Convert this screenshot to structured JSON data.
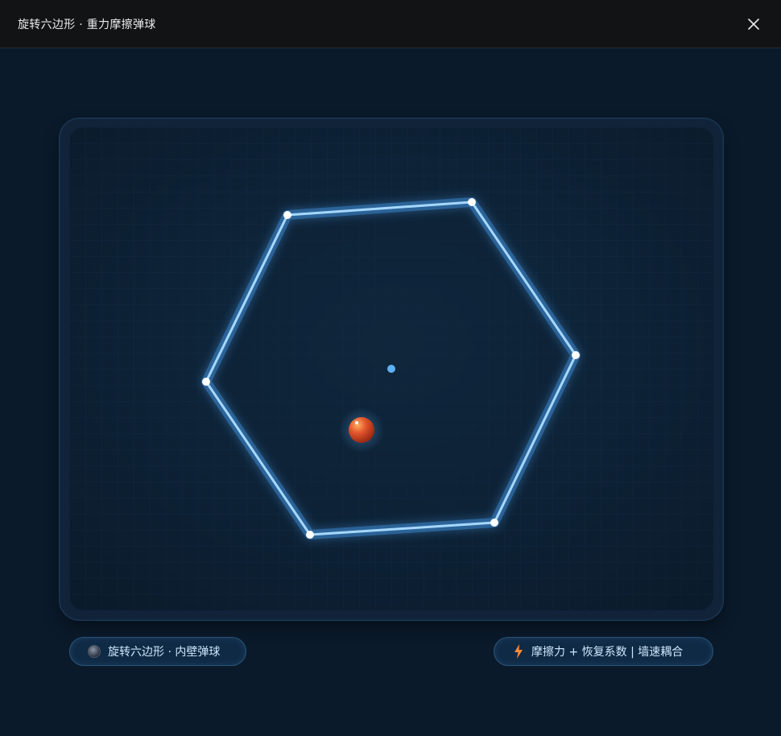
{
  "window": {
    "title": "旋转六边形 · 重力摩擦弹球",
    "close_icon": "close-icon"
  },
  "badges": {
    "left": {
      "icon": "ball-icon",
      "label": "旋转六边形 · 内壁弹球"
    },
    "right": {
      "icon": "lightning-icon",
      "label": "摩擦力 + 恢复系数 | 墙速耦合"
    }
  },
  "colors": {
    "background": "#0a1a2b",
    "hexagon_stroke": "#9fd3ff",
    "vertex": "#ffffff",
    "center_dot": "#5fb0f5",
    "ball": "#e4572e",
    "bolt": "#ff8a3d"
  }
}
